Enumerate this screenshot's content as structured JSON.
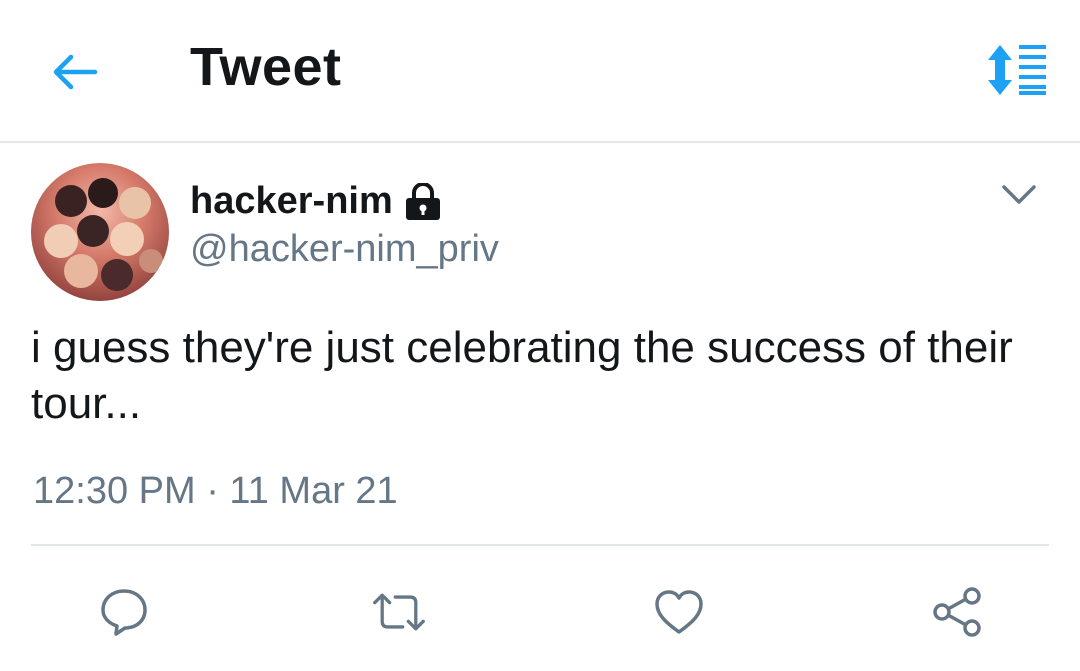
{
  "header": {
    "title": "Tweet",
    "back_icon": "arrow-left-icon",
    "sort_icon": "sort-updown-icon"
  },
  "tweet": {
    "author_name": "hacker-nim",
    "author_handle": "@hacker-nim_priv",
    "protected_icon": "lock-icon",
    "text": "i guess they're just celebrating the success of their tour...",
    "timestamp": "12:30 PM · 11 Mar 21"
  },
  "actions": [
    {
      "icon": "reply-icon"
    },
    {
      "icon": "retweet-icon"
    },
    {
      "icon": "like-icon"
    },
    {
      "icon": "share-icon"
    }
  ],
  "colors": {
    "accent": "#1da1f2",
    "text": "#14171a",
    "secondary": "#657786",
    "divider": "#e1e8ed"
  }
}
